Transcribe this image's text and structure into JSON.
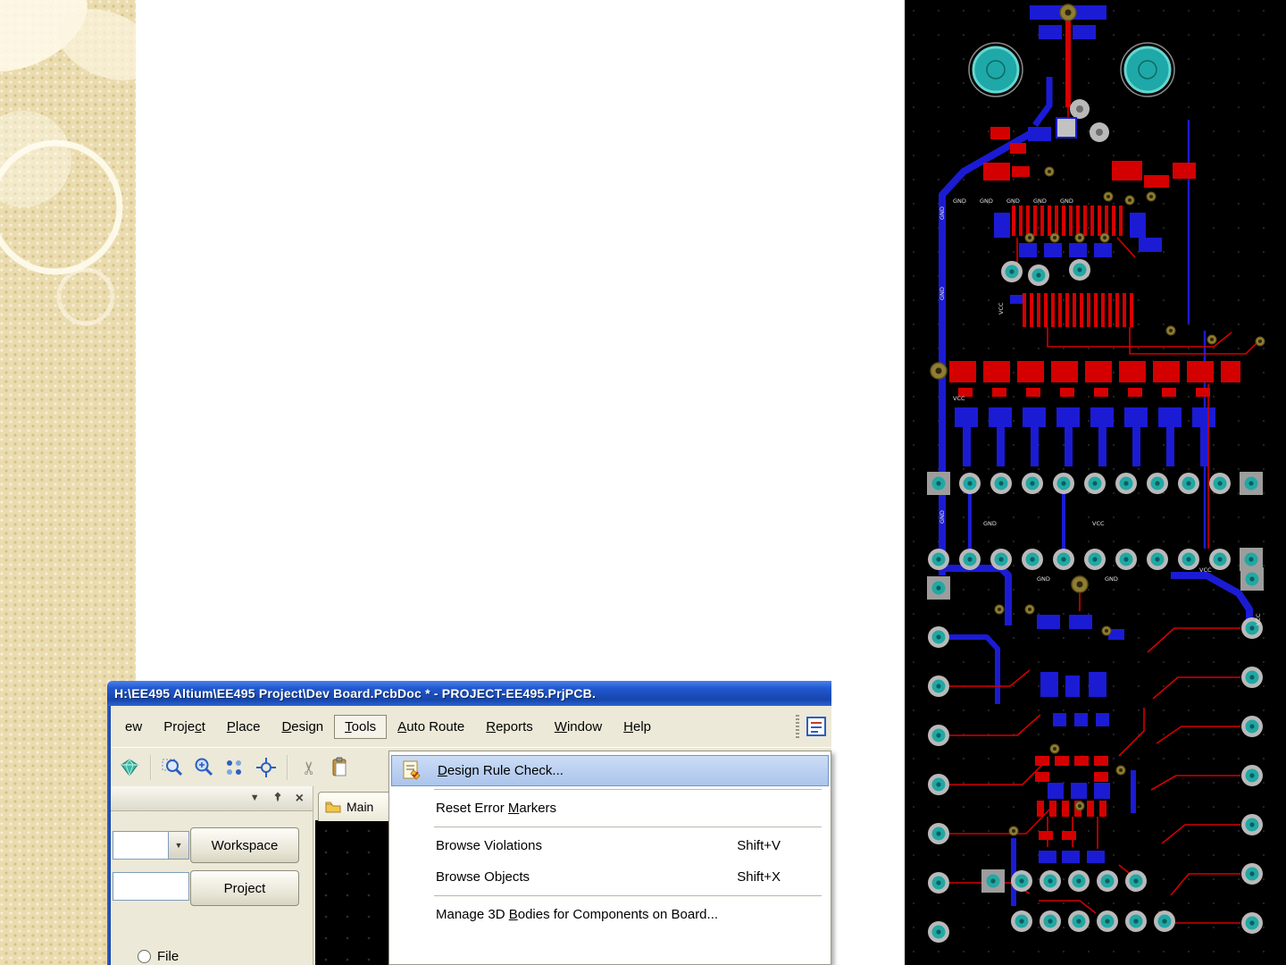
{
  "window": {
    "title": "H:\\EE495 Altium\\EE495 Project\\Dev Board.PcbDoc * - PROJECT-EE495.PrjPCB. ",
    "menubar": [
      {
        "label": "ew",
        "u": -1
      },
      {
        "label": "Project",
        "u": 5
      },
      {
        "label": "Place",
        "u": 0
      },
      {
        "label": "Design",
        "u": 0
      },
      {
        "label": "Tools",
        "u": 0
      },
      {
        "label": "Auto Route",
        "u": 0
      },
      {
        "label": "Reports",
        "u": 0
      },
      {
        "label": "Window",
        "u": 0
      },
      {
        "label": "Help",
        "u": 0
      }
    ],
    "tools_menu": [
      {
        "label": "Design Rule Check...",
        "u": 0,
        "shortcut": "",
        "highlighted": true
      },
      {
        "label": "Reset Error Markers",
        "u": 12,
        "shortcut": ""
      },
      {
        "label": "Browse Violations",
        "u": -1,
        "shortcut": "Shift+V"
      },
      {
        "label": "Browse Objects",
        "u": -1,
        "shortcut": "Shift+X"
      },
      {
        "label": "Manage 3D Bodies for Components on Board...",
        "u": 10,
        "shortcut": ""
      }
    ],
    "projects_panel": {
      "workspace_button": "Workspace",
      "project_button": "Project",
      "file_option": "File"
    },
    "document_tab": "Main"
  },
  "pcb": {
    "net_labels": [
      "GND",
      "VCC"
    ]
  },
  "colors": {
    "titlebar_blue": "#2158cf",
    "menu_bg": "#ece9d8",
    "menu_highlight": "#a9c4ec",
    "strip_beige": "#eadcae",
    "pcb_background": "#000000",
    "pcb_copper_top": "#d40000",
    "pcb_copper_bottom": "#1b1bd4",
    "pcb_pad_teal": "#21a8a4"
  }
}
